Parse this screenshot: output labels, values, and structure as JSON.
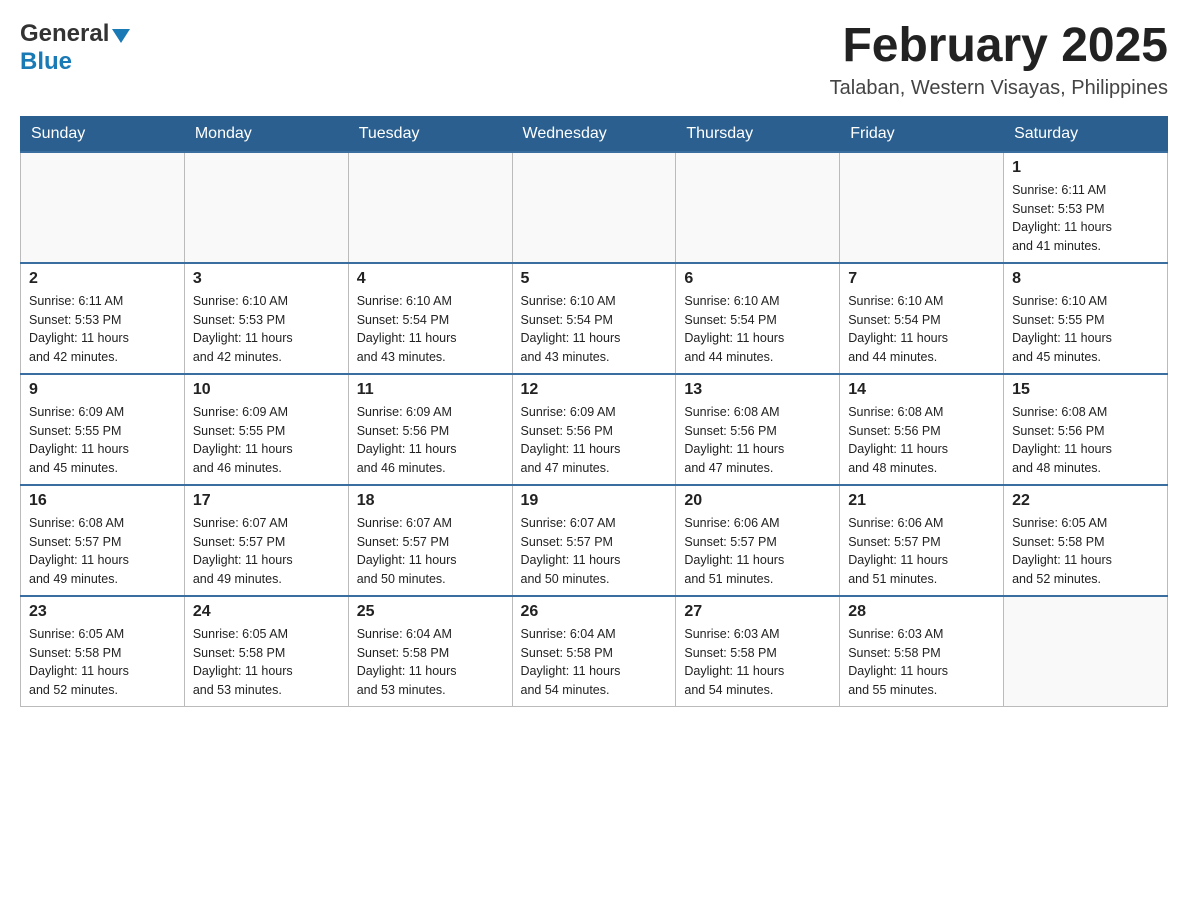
{
  "header": {
    "logo": {
      "general": "General",
      "blue": "Blue",
      "triangle_color": "#1a7ab5"
    },
    "title": "February 2025",
    "location": "Talaban, Western Visayas, Philippines"
  },
  "days_of_week": [
    "Sunday",
    "Monday",
    "Tuesday",
    "Wednesday",
    "Thursday",
    "Friday",
    "Saturday"
  ],
  "weeks": [
    {
      "days": [
        {
          "number": "",
          "info": ""
        },
        {
          "number": "",
          "info": ""
        },
        {
          "number": "",
          "info": ""
        },
        {
          "number": "",
          "info": ""
        },
        {
          "number": "",
          "info": ""
        },
        {
          "number": "",
          "info": ""
        },
        {
          "number": "1",
          "info": "Sunrise: 6:11 AM\nSunset: 5:53 PM\nDaylight: 11 hours\nand 41 minutes."
        }
      ]
    },
    {
      "days": [
        {
          "number": "2",
          "info": "Sunrise: 6:11 AM\nSunset: 5:53 PM\nDaylight: 11 hours\nand 42 minutes."
        },
        {
          "number": "3",
          "info": "Sunrise: 6:10 AM\nSunset: 5:53 PM\nDaylight: 11 hours\nand 42 minutes."
        },
        {
          "number": "4",
          "info": "Sunrise: 6:10 AM\nSunset: 5:54 PM\nDaylight: 11 hours\nand 43 minutes."
        },
        {
          "number": "5",
          "info": "Sunrise: 6:10 AM\nSunset: 5:54 PM\nDaylight: 11 hours\nand 43 minutes."
        },
        {
          "number": "6",
          "info": "Sunrise: 6:10 AM\nSunset: 5:54 PM\nDaylight: 11 hours\nand 44 minutes."
        },
        {
          "number": "7",
          "info": "Sunrise: 6:10 AM\nSunset: 5:54 PM\nDaylight: 11 hours\nand 44 minutes."
        },
        {
          "number": "8",
          "info": "Sunrise: 6:10 AM\nSunset: 5:55 PM\nDaylight: 11 hours\nand 45 minutes."
        }
      ]
    },
    {
      "days": [
        {
          "number": "9",
          "info": "Sunrise: 6:09 AM\nSunset: 5:55 PM\nDaylight: 11 hours\nand 45 minutes."
        },
        {
          "number": "10",
          "info": "Sunrise: 6:09 AM\nSunset: 5:55 PM\nDaylight: 11 hours\nand 46 minutes."
        },
        {
          "number": "11",
          "info": "Sunrise: 6:09 AM\nSunset: 5:56 PM\nDaylight: 11 hours\nand 46 minutes."
        },
        {
          "number": "12",
          "info": "Sunrise: 6:09 AM\nSunset: 5:56 PM\nDaylight: 11 hours\nand 47 minutes."
        },
        {
          "number": "13",
          "info": "Sunrise: 6:08 AM\nSunset: 5:56 PM\nDaylight: 11 hours\nand 47 minutes."
        },
        {
          "number": "14",
          "info": "Sunrise: 6:08 AM\nSunset: 5:56 PM\nDaylight: 11 hours\nand 48 minutes."
        },
        {
          "number": "15",
          "info": "Sunrise: 6:08 AM\nSunset: 5:56 PM\nDaylight: 11 hours\nand 48 minutes."
        }
      ]
    },
    {
      "days": [
        {
          "number": "16",
          "info": "Sunrise: 6:08 AM\nSunset: 5:57 PM\nDaylight: 11 hours\nand 49 minutes."
        },
        {
          "number": "17",
          "info": "Sunrise: 6:07 AM\nSunset: 5:57 PM\nDaylight: 11 hours\nand 49 minutes."
        },
        {
          "number": "18",
          "info": "Sunrise: 6:07 AM\nSunset: 5:57 PM\nDaylight: 11 hours\nand 50 minutes."
        },
        {
          "number": "19",
          "info": "Sunrise: 6:07 AM\nSunset: 5:57 PM\nDaylight: 11 hours\nand 50 minutes."
        },
        {
          "number": "20",
          "info": "Sunrise: 6:06 AM\nSunset: 5:57 PM\nDaylight: 11 hours\nand 51 minutes."
        },
        {
          "number": "21",
          "info": "Sunrise: 6:06 AM\nSunset: 5:57 PM\nDaylight: 11 hours\nand 51 minutes."
        },
        {
          "number": "22",
          "info": "Sunrise: 6:05 AM\nSunset: 5:58 PM\nDaylight: 11 hours\nand 52 minutes."
        }
      ]
    },
    {
      "days": [
        {
          "number": "23",
          "info": "Sunrise: 6:05 AM\nSunset: 5:58 PM\nDaylight: 11 hours\nand 52 minutes."
        },
        {
          "number": "24",
          "info": "Sunrise: 6:05 AM\nSunset: 5:58 PM\nDaylight: 11 hours\nand 53 minutes."
        },
        {
          "number": "25",
          "info": "Sunrise: 6:04 AM\nSunset: 5:58 PM\nDaylight: 11 hours\nand 53 minutes."
        },
        {
          "number": "26",
          "info": "Sunrise: 6:04 AM\nSunset: 5:58 PM\nDaylight: 11 hours\nand 54 minutes."
        },
        {
          "number": "27",
          "info": "Sunrise: 6:03 AM\nSunset: 5:58 PM\nDaylight: 11 hours\nand 54 minutes."
        },
        {
          "number": "28",
          "info": "Sunrise: 6:03 AM\nSunset: 5:58 PM\nDaylight: 11 hours\nand 55 minutes."
        },
        {
          "number": "",
          "info": ""
        }
      ]
    }
  ]
}
